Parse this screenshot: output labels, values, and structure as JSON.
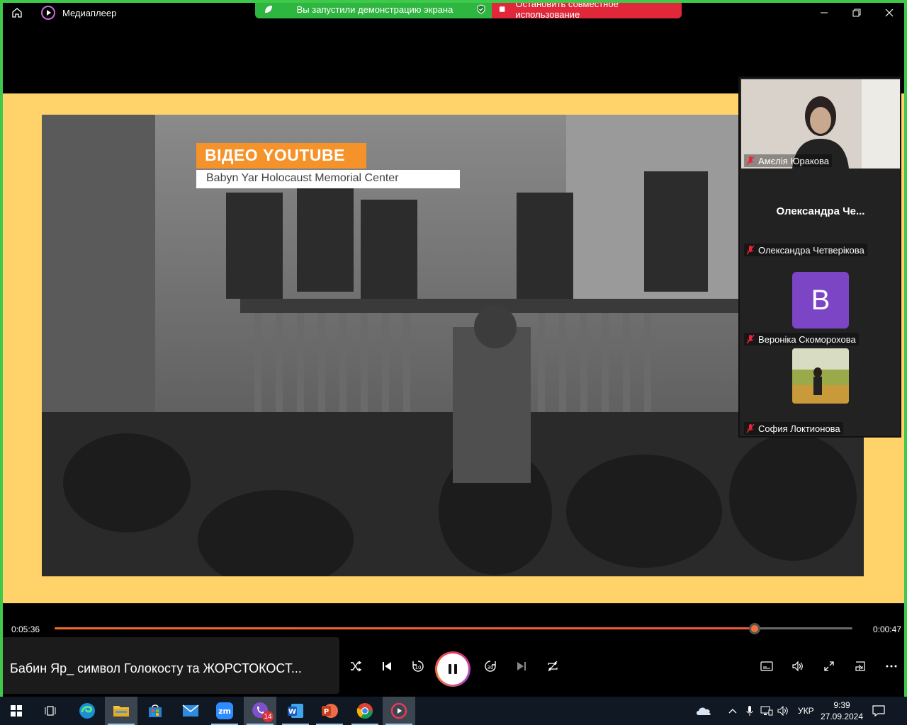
{
  "app": {
    "title": "Медиаплеер"
  },
  "share_banner": {
    "status_text": "Вы запустили демонстрацию экрана",
    "stop_text": "Остановить совместное использование"
  },
  "video": {
    "badge_text": "ВІДЕО YOUTUBE",
    "sub_text": "Babyn Yar Holocaust Memorial Center"
  },
  "participants": [
    {
      "name": "Амєлія Юракова",
      "muted": true
    },
    {
      "display": "Олександра  Че...",
      "name": "Олександра Четверікова",
      "muted": true
    },
    {
      "avatar_letter": "В",
      "name": "Вероніка Скоморохова",
      "muted": true
    },
    {
      "name": "София Локтионова",
      "muted": true
    }
  ],
  "player": {
    "time_current": "0:05:36",
    "time_remaining": "0:00:47",
    "progress": 0.877,
    "track_title": "Бабин Яр_ символ Голокосту та ЖОРСТОКОСТ...",
    "skip_back_seconds": "10",
    "skip_forward_seconds": "30"
  },
  "taskbar": {
    "lang": "УКР",
    "time": "9:39",
    "date": "27.09.2024",
    "viber_badge": "14"
  },
  "colors": {
    "share_green": "#2fb640",
    "stop_red": "#e0283a",
    "video_border": "#ffd26a",
    "progress_orange": "#f56b2a",
    "avatar_purple": "#7c45c6"
  }
}
